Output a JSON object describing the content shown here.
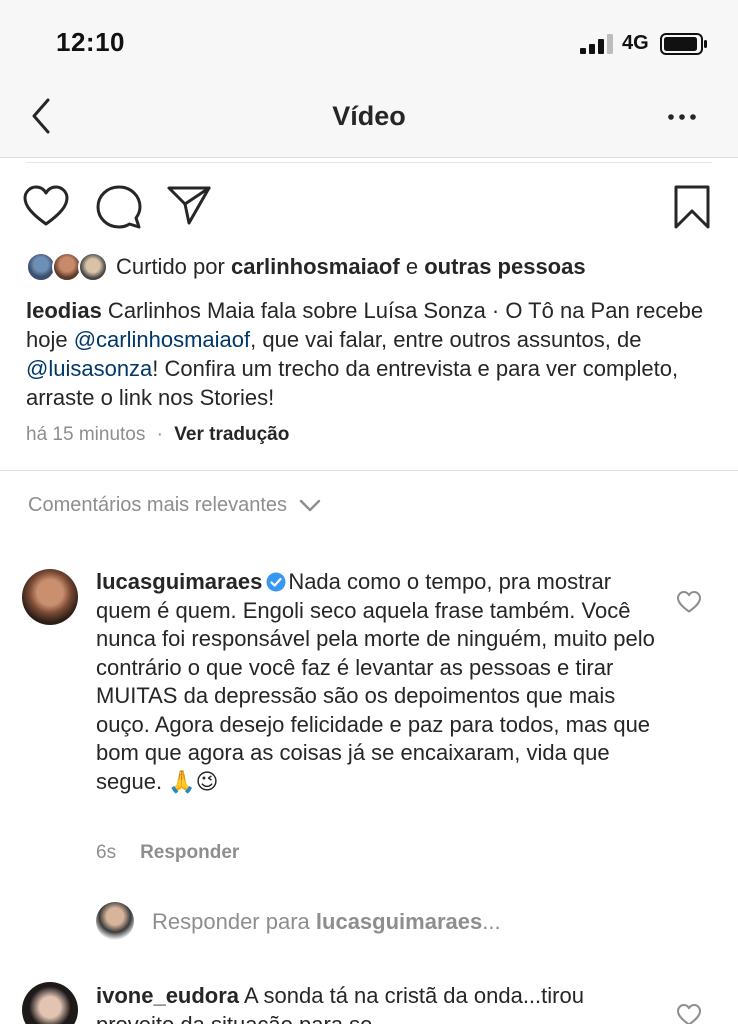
{
  "status": {
    "time": "12:10",
    "network": "4G"
  },
  "nav": {
    "title": "Vídeo"
  },
  "liked": {
    "prefix": "Curtido por",
    "user": "carlinhosmaiaof",
    "connector": "e",
    "others": "outras pessoas"
  },
  "caption": {
    "username": "leodias",
    "part1": " Carlinhos Maia fala sobre Luísa Sonza · O Tô na Pan recebe hoje ",
    "mention1": "@carlinhosmaiaof",
    "part2": ", que vai falar, entre outros assuntos, de ",
    "mention2": "@luisasonza",
    "part3": "! Confira um trecho da entrevista e para ver completo, arraste o link nos Stories!",
    "time_ago": "há 15 minutos",
    "separator": "·",
    "see_translation": "Ver tradução"
  },
  "comments_header": "Comentários mais relevantes",
  "comments": [
    {
      "username": "lucasguimaraes",
      "text": "Nada como o tempo, pra mostrar quem é quem. Engoli seco aquela frase também. Você nunca foi responsável pela morte de ninguém, muito pelo contrário o que você faz é levantar as pessoas e tirar MUITAS da depressão são os depoimentos que mais ouço. Agora desejo felicidade e paz para todos, mas que bom que agora as coisas já se encaixaram, vida que segue. 🙏😉",
      "time": "6s",
      "reply_label": "Responder"
    },
    {
      "username": "ivone_eudora",
      "text": "A sonda tá na cristã da onda...tirou proveito da situação para se"
    }
  ],
  "reply_box": {
    "prefix": "Responder para",
    "target": "lucasguimaraes",
    "suffix": "..."
  },
  "icons": {
    "back": "chevron-left-icon",
    "more": "more-horizontal-icon",
    "like": "heart-icon",
    "comment": "comment-bubble-icon",
    "share": "paper-plane-icon",
    "save": "bookmark-icon"
  }
}
